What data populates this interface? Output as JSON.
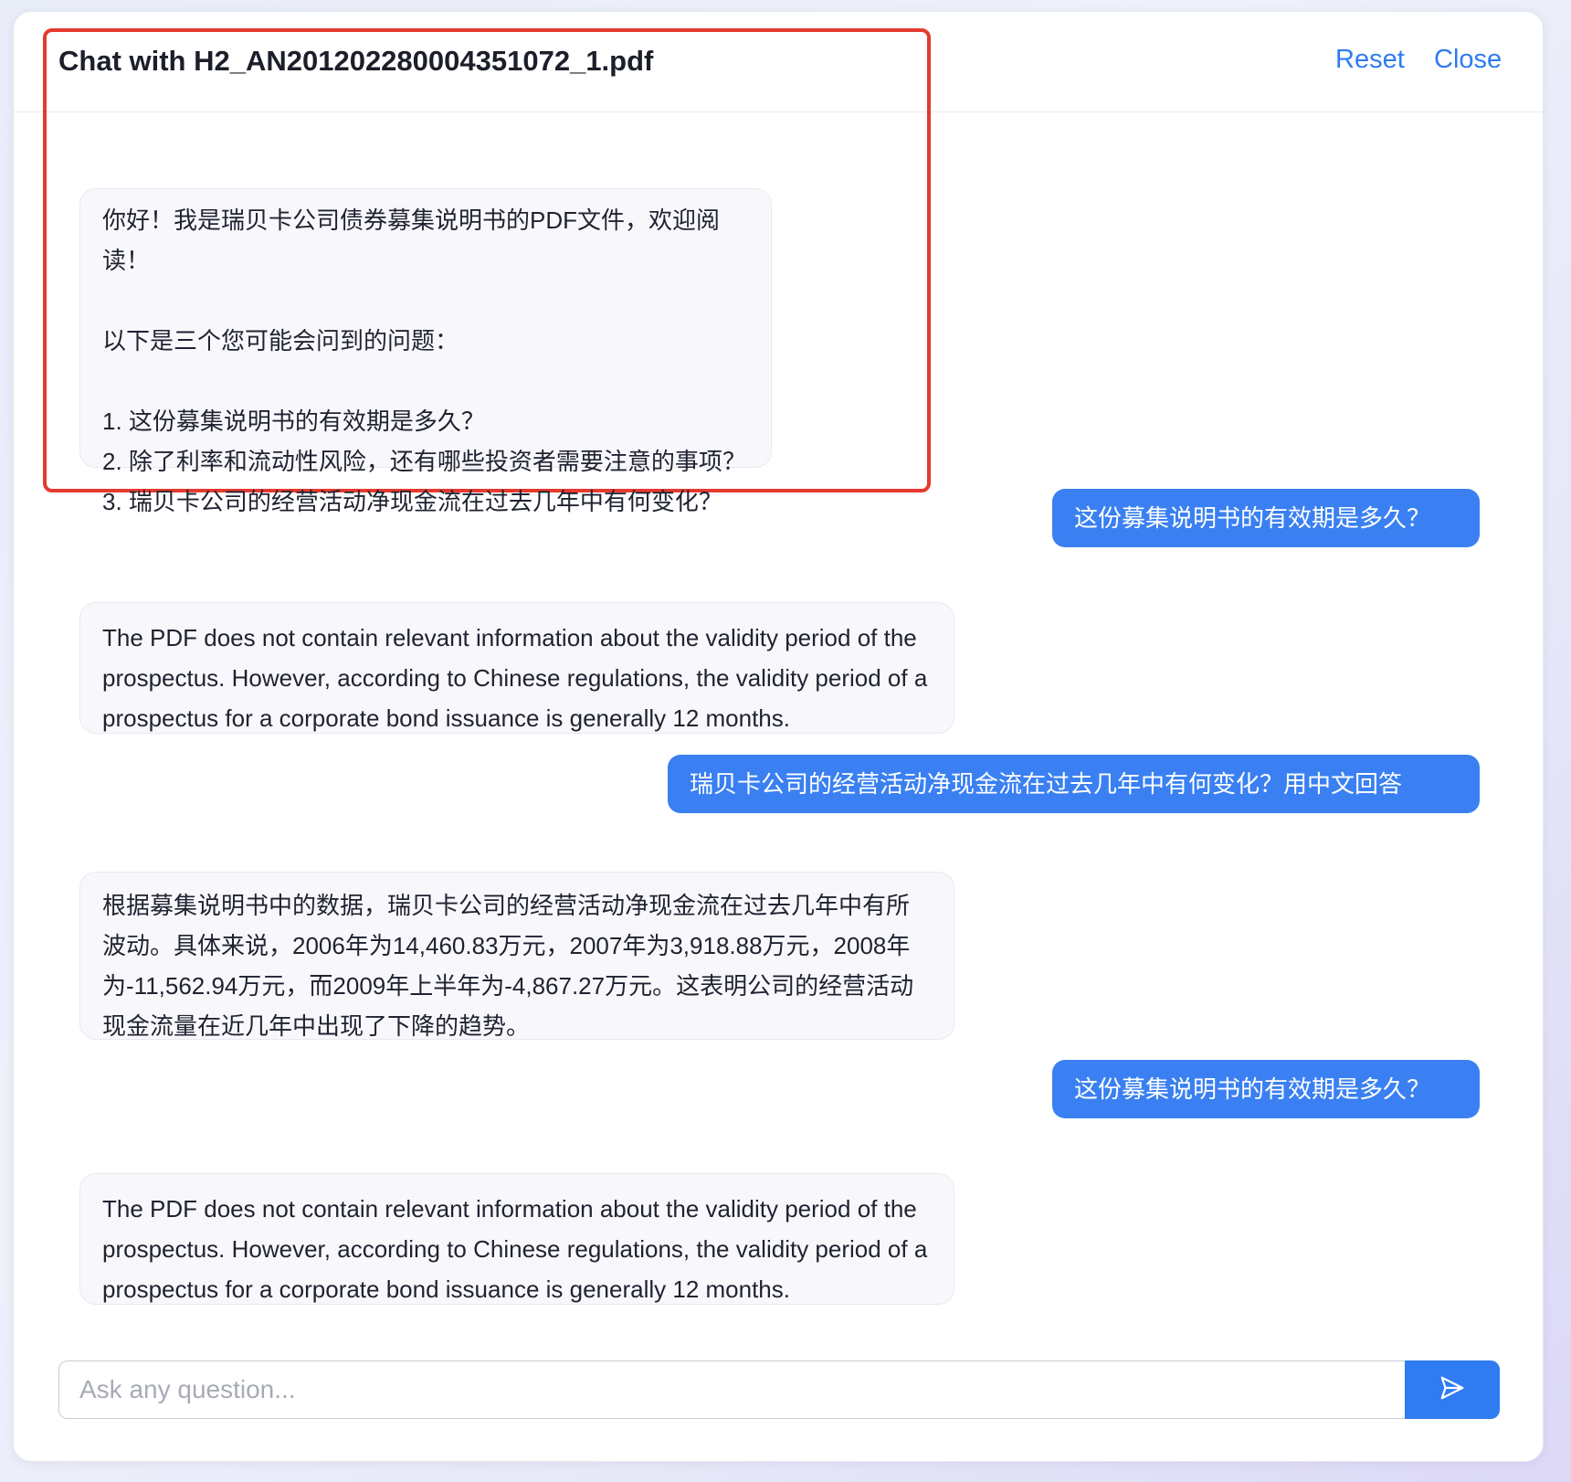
{
  "header": {
    "title": "Chat with H2_AN201202280004351072_1.pdf",
    "reset_label": "Reset",
    "close_label": "Close"
  },
  "messages": [
    {
      "role": "assistant",
      "text": "你好！我是瑞贝卡公司债券募集说明书的PDF文件，欢迎阅读！\n\n以下是三个您可能会问到的问题：\n\n1. 这份募集说明书的有效期是多久？\n2. 除了利率和流动性风险，还有哪些投资者需要注意的事项？\n3. 瑞贝卡公司的经营活动净现金流在过去几年中有何变化？"
    },
    {
      "role": "user",
      "text": "这份募集说明书的有效期是多久？"
    },
    {
      "role": "assistant",
      "text": "The PDF does not contain relevant information about the validity period of the prospectus. However, according to Chinese regulations, the validity period of a prospectus for a corporate bond issuance is generally 12 months."
    },
    {
      "role": "user",
      "text": "瑞贝卡公司的经营活动净现金流在过去几年中有何变化？用中文回答"
    },
    {
      "role": "assistant",
      "text": "根据募集说明书中的数据，瑞贝卡公司的经营活动净现金流在过去几年中有所波动。具体来说，2006年为14,460.83万元，2007年为3,918.88万元，2008年为-11,562.94万元，而2009年上半年为-4,867.27万元。这表明公司的经营活动现金流量在近几年中出现了下降的趋势。"
    },
    {
      "role": "user",
      "text": "这份募集说明书的有效期是多久？"
    },
    {
      "role": "assistant",
      "text": "The PDF does not contain relevant information about the validity period of the prospectus. However, according to Chinese regulations, the validity period of a prospectus for a corporate bond issuance is generally 12 months."
    }
  ],
  "composer": {
    "placeholder": "Ask any question..."
  },
  "icons": {
    "send": "send-icon"
  },
  "colors": {
    "accent": "#2f7bf2",
    "user_bubble": "#3a80f2",
    "highlight_border": "#e63a2e"
  }
}
